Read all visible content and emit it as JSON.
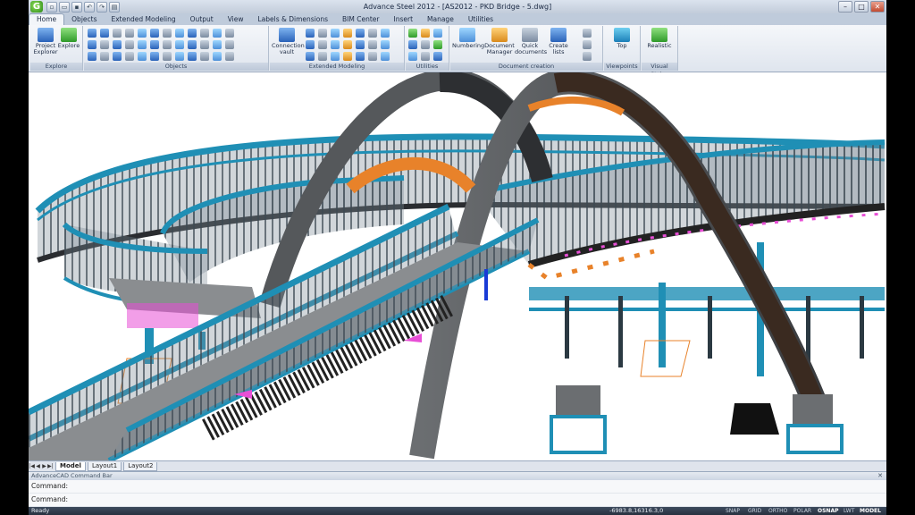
{
  "window": {
    "title": "Advance Steel 2012 - [AS2012 - PKD Bridge - 5.dwg]",
    "app_logo": "G",
    "controls": {
      "minimize": "–",
      "maximize": "□",
      "close": "✕"
    }
  },
  "ribbon_tabs": [
    "Home",
    "Objects",
    "Extended Modeling",
    "Output",
    "View",
    "Labels & Dimensions",
    "BIM Center",
    "Insert",
    "Manage",
    "Utilities"
  ],
  "active_tab": "Home",
  "ribbon": {
    "groups": {
      "explore": "Explore",
      "objects": "Objects",
      "extended_modeling": "Extended Modeling",
      "utilities": "Utilities",
      "document_creation": "Document creation",
      "viewpoints": "Viewpoints",
      "visual_styles": "Visual Styles"
    },
    "buttons": {
      "project_explorer": "Project Explorer",
      "explore": "Explore",
      "connection_vault": "Connection vault",
      "numbering": "Numbering",
      "document_manager": "Document Manager",
      "quick_documents": "Quick documents",
      "create_lists": "Create lists",
      "top": "Top",
      "realistic": "Realistic"
    }
  },
  "layout_tabs": [
    "Model",
    "Layout1",
    "Layout2"
  ],
  "active_layout": "Model",
  "command_bar": {
    "title": "AdvanceCAD Command Bar",
    "lines": [
      "Command:",
      "Command:"
    ]
  },
  "status_bar": {
    "ready": "Ready",
    "coordinates": "-6983.8,16316.3,0",
    "toggles": [
      "SNAP",
      "GRID",
      "ORTHO",
      "POLAR",
      "OSNAP",
      "LWT",
      "MODEL"
    ],
    "active_toggles": [
      "OSNAP",
      "MODEL"
    ]
  },
  "colors": {
    "railing": "#1f8fb5",
    "deck": "#7a7d80",
    "arch": "#5d5f62",
    "accent_orange": "#e8822a",
    "accent_magenta": "#e84fd6"
  },
  "icons": {
    "qat": [
      "new-icon",
      "open-icon",
      "save-icon",
      "undo-icon",
      "redo-icon",
      "print-icon"
    ]
  }
}
